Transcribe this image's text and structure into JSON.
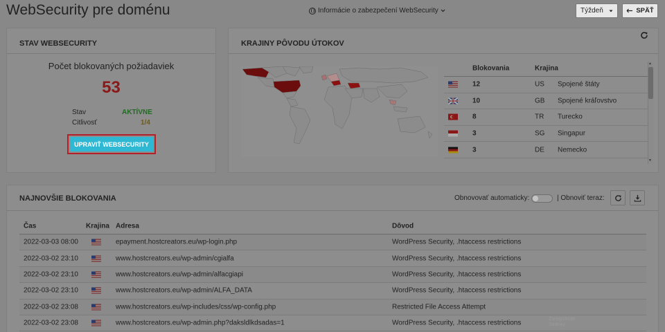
{
  "header": {
    "title": "WebSecurity pre doménu",
    "info_link": "Informácie o zabezpečení WebSecurity",
    "period": "Týždeň",
    "back": "SPÄŤ"
  },
  "status": {
    "title": "STAV WEBSECURITY",
    "requests_label": "Počet blokovaných požiadaviek",
    "requests_count": "53",
    "state_label": "Stav",
    "state_value": "AKTÍVNE",
    "sensitivity_label": "Citlivosť",
    "sensitivity_value": "1/4",
    "edit_button": "UPRAVIŤ WEBSECURITY"
  },
  "countries": {
    "title": "KRAJINY PÔVODU ÚTOKOV",
    "headers": {
      "blocks": "Blokovania",
      "country": "Krajina"
    },
    "rows": [
      {
        "flag": "us",
        "blocks": "12",
        "code": "US",
        "name": "Spojené štáty"
      },
      {
        "flag": "gb",
        "blocks": "10",
        "code": "GB",
        "name": "Spojené kráľovstvo"
      },
      {
        "flag": "tr",
        "blocks": "8",
        "code": "TR",
        "name": "Turecko"
      },
      {
        "flag": "sg",
        "blocks": "3",
        "code": "SG",
        "name": "Singapur"
      },
      {
        "flag": "de",
        "blocks": "3",
        "code": "DE",
        "name": "Nemecko"
      }
    ]
  },
  "latest": {
    "title": "NAJNOVŠIE BLOKOVANIA",
    "auto_refresh_label": "Obnovovať automaticky:",
    "auto_refresh_on": false,
    "refresh_now_label": "| Obnoviť teraz:",
    "headers": {
      "time": "Čas",
      "country": "Krajina",
      "address": "Adresa",
      "reason": "Dôvod"
    },
    "rows": [
      {
        "time": "2022-03-03 08:00",
        "flag": "us",
        "address": "epayment.hostcreators.eu/wp-login.php",
        "reason": "WordPress Security, .htaccess restrictions"
      },
      {
        "time": "2022-03-02 23:10",
        "flag": "us",
        "address": "www.hostcreators.eu/wp-admin/cgialfa",
        "reason": "WordPress Security, .htaccess restrictions"
      },
      {
        "time": "2022-03-02 23:10",
        "flag": "us",
        "address": "www.hostcreators.eu/wp-admin/alfacgiapi",
        "reason": "WordPress Security, .htaccess restrictions"
      },
      {
        "time": "2022-03-02 23:10",
        "flag": "us",
        "address": "www.hostcreators.eu/wp-admin/ALFA_DATA",
        "reason": "WordPress Security, .htaccess restrictions"
      },
      {
        "time": "2022-03-02 23:08",
        "flag": "us",
        "address": "www.hostcreators.eu/wp-includes/css/wp-config.php",
        "reason": "Restricted File Access Attempt"
      },
      {
        "time": "2022-03-02 23:08",
        "flag": "us",
        "address": "www.hostcreators.eu/wp-admin.php?daksldlkdsadas=1",
        "reason": "WordPress Security, .htaccess restrictions"
      }
    ]
  },
  "colors": {
    "accent_count": "#8a1a1a",
    "active": "#226b22",
    "button": "#2fb8d3",
    "button_outline": "#b3202a",
    "map_heavy": "#6b0d0d"
  },
  "icons": [
    "globe-icon",
    "chevron-down-icon",
    "arrow-left-icon",
    "refresh-icon",
    "download-icon"
  ]
}
